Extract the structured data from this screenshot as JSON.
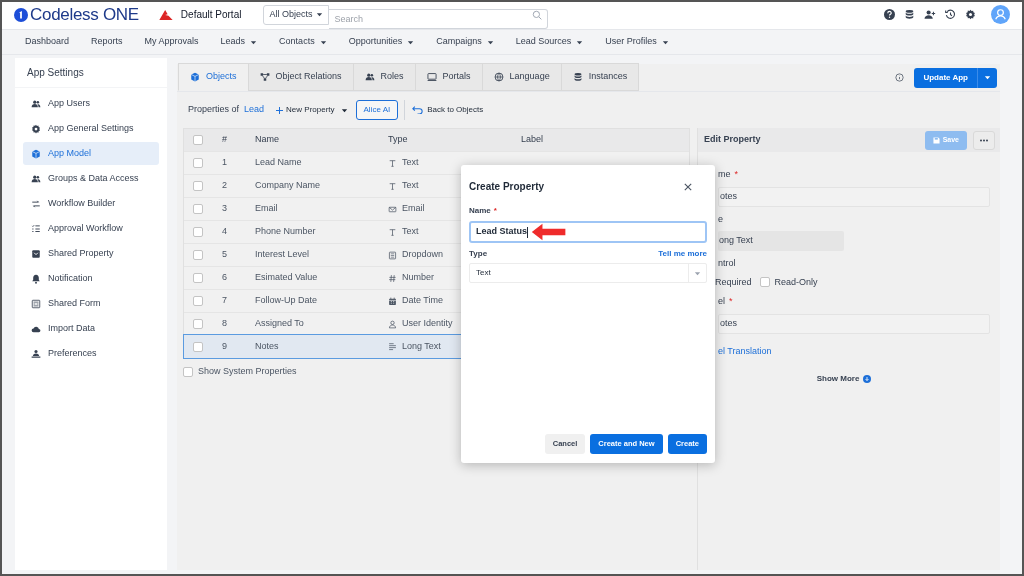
{
  "header": {
    "logo_text": "Codeless ONE",
    "portal": "Default Portal",
    "scope": "All Objects",
    "search": {
      "placeholder": "Search"
    }
  },
  "nav": [
    {
      "label": "Dashboard",
      "dropdown": false
    },
    {
      "label": "Reports",
      "dropdown": false
    },
    {
      "label": "My Approvals",
      "dropdown": false
    },
    {
      "label": "Leads",
      "dropdown": true
    },
    {
      "label": "Contacts",
      "dropdown": true
    },
    {
      "label": "Opportunities",
      "dropdown": true
    },
    {
      "label": "Campaigns",
      "dropdown": true
    },
    {
      "label": "Lead Sources",
      "dropdown": true
    },
    {
      "label": "User Profiles",
      "dropdown": true
    }
  ],
  "sidebar": {
    "title": "App Settings",
    "items": [
      {
        "label": "App Users",
        "kind": "users",
        "selected": false
      },
      {
        "label": "App General Settings",
        "kind": "gear",
        "selected": false
      },
      {
        "label": "App Model",
        "kind": "cube",
        "selected": true
      },
      {
        "label": "Groups & Data Access",
        "kind": "users",
        "selected": false
      },
      {
        "label": "Workflow Builder",
        "kind": "arrows",
        "selected": false
      },
      {
        "label": "Approval Workflow",
        "kind": "list",
        "selected": false
      },
      {
        "label": "Shared Property",
        "kind": "square",
        "selected": false
      },
      {
        "label": "Notification",
        "kind": "bell",
        "selected": false
      },
      {
        "label": "Shared Form",
        "kind": "form",
        "selected": false
      },
      {
        "label": "Import Data",
        "kind": "cloud",
        "selected": false
      },
      {
        "label": "Preferences",
        "kind": "person",
        "selected": false
      }
    ]
  },
  "tabs": [
    {
      "label": "Objects",
      "kind": "cube",
      "selected": true
    },
    {
      "label": "Object Relations",
      "kind": "nodes",
      "selected": false
    },
    {
      "label": "Roles",
      "kind": "users",
      "selected": false
    },
    {
      "label": "Portals",
      "kind": "monitor",
      "selected": false
    },
    {
      "label": "Language",
      "kind": "globe",
      "selected": false
    },
    {
      "label": "Instances",
      "kind": "database",
      "selected": false
    }
  ],
  "update_button": "Update App",
  "toolbar": {
    "prefix": "Properties of",
    "object": "Lead",
    "new_property": "New Property",
    "alice": "Alice AI",
    "back": "Back to Objects"
  },
  "table": {
    "all_checked": false,
    "columns": [
      "#",
      "Name",
      "Type",
      "Label"
    ],
    "rows": [
      {
        "num": "1",
        "name": "Lead Name",
        "type": "Text",
        "kind": "text",
        "checked": false,
        "selected": false
      },
      {
        "num": "2",
        "name": "Company Name",
        "type": "Text",
        "kind": "text",
        "checked": false,
        "selected": false
      },
      {
        "num": "3",
        "name": "Email",
        "type": "Email",
        "kind": "mail",
        "checked": false,
        "selected": false
      },
      {
        "num": "4",
        "name": "Phone Number",
        "type": "Text",
        "kind": "text",
        "checked": false,
        "selected": false
      },
      {
        "num": "5",
        "name": "Interest Level",
        "type": "Dropdown",
        "kind": "dropdown",
        "checked": false,
        "selected": false
      },
      {
        "num": "6",
        "name": "Esimated Value",
        "type": "Number",
        "kind": "hash",
        "checked": false,
        "selected": false
      },
      {
        "num": "7",
        "name": "Follow-Up Date",
        "type": "Date Time",
        "kind": "calendar",
        "checked": false,
        "selected": false
      },
      {
        "num": "8",
        "name": "Assigned To",
        "type": "User Identity",
        "kind": "user",
        "checked": false,
        "selected": false
      },
      {
        "num": "9",
        "name": "Notes",
        "type": "Long Text",
        "kind": "lines",
        "checked": false,
        "selected": true
      }
    ]
  },
  "show_system": {
    "label": "Show System Properties",
    "checked": false
  },
  "edit_panel": {
    "title": "Edit Property",
    "save": "Save",
    "save_disabled": true,
    "fields": [
      {
        "kind": "input",
        "label": "me",
        "mark": "*",
        "value": "otes"
      },
      {
        "kind": "readonly",
        "label": "e",
        "value": "ong Text"
      },
      {
        "kind": "checks",
        "label": "ntrol",
        "options": [
          {
            "label": "Required"
          },
          {
            "label": "Read-Only",
            "checked": false
          }
        ]
      },
      {
        "kind": "input",
        "label": "el",
        "mark": "*",
        "value": "otes"
      }
    ],
    "link": "el Translation",
    "show_more": "Show More"
  },
  "dialog": {
    "title": "Create Property",
    "name_label": "Name",
    "name_mark": "*",
    "name_value": "Lead Status",
    "type_label": "Type",
    "help_link": "Tell me more",
    "type_value": "Text",
    "buttons": [
      {
        "label": "Cancel",
        "kind": "secondary"
      },
      {
        "label": "Create and New",
        "kind": "primary"
      },
      {
        "label": "Create",
        "kind": "primary"
      }
    ]
  }
}
